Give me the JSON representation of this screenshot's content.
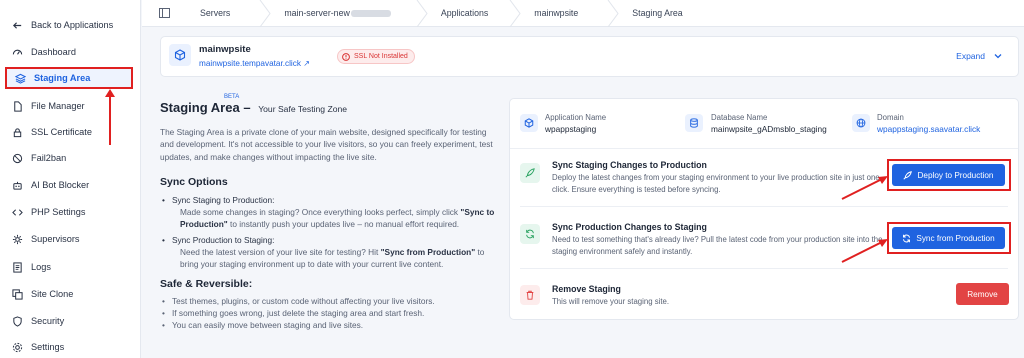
{
  "sidebar": {
    "back_label": "Back to Applications",
    "items": [
      {
        "label": "Dashboard",
        "icon": "dashboard-icon"
      },
      {
        "label": "Staging Area",
        "icon": "layers-icon"
      },
      {
        "label": "File Manager",
        "icon": "file-icon"
      },
      {
        "label": "SSL Certificate",
        "icon": "lock-icon"
      },
      {
        "label": "Fail2ban",
        "icon": "ban-icon"
      },
      {
        "label": "AI Bot Blocker",
        "icon": "robot-icon"
      },
      {
        "label": "PHP Settings",
        "icon": "code-icon"
      },
      {
        "label": "Supervisors",
        "icon": "gear-icon"
      },
      {
        "label": "Logs",
        "icon": "log-icon"
      },
      {
        "label": "Site Clone",
        "icon": "copy-icon"
      },
      {
        "label": "Security",
        "icon": "shield-icon"
      },
      {
        "label": "Settings",
        "icon": "settings-icon"
      }
    ]
  },
  "breadcrumb": {
    "items": [
      "Servers",
      "main-server-new",
      "Applications",
      "mainwpsite",
      "Staging Area"
    ]
  },
  "site": {
    "name": "mainwpsite",
    "url": "mainwpsite.tempavatar.click",
    "ssl_badge": "SSL Not Installed",
    "expand_label": "Expand"
  },
  "intro": {
    "title": "Staging Area",
    "beta": "BETA",
    "subtitle": "Your Safe Testing Zone",
    "description": "The Staging Area is a private clone of your main website, designed specifically for testing and development. It's not accessible to your live visitors, so you can freely experiment, test updates, and make changes without impacting the live site."
  },
  "sync_options": {
    "heading": "Sync Options",
    "items": [
      {
        "title": "Sync Staging to Production:",
        "pre": "Made some changes in staging? Once everything looks perfect, simply click ",
        "bold": "\"Sync to Production\"",
        "post": " to instantly push your updates live – no manual effort required."
      },
      {
        "title": "Sync Production to Staging:",
        "pre": "Need the latest version of your live site for testing? Hit ",
        "bold": "\"Sync from Production\"",
        "post": " to bring your staging environment up to date with your current live content."
      }
    ]
  },
  "safe": {
    "heading": "Safe & Reversible:",
    "items": [
      "Test themes, plugins, or custom code without affecting your live visitors.",
      "If something goes wrong, just delete the staging area and start fresh.",
      "You can easily move between staging and live sites."
    ]
  },
  "info": {
    "app_label": "Application Name",
    "app_value": "wpappstaging",
    "db_label": "Database Name",
    "db_value": "mainwpsite_gADmsblo_staging",
    "domain_label": "Domain",
    "domain_value": "wpappstaging.saavatar.click"
  },
  "actions": {
    "deploy": {
      "title": "Sync Staging Changes to Production",
      "desc": "Deploy the latest changes from your staging environment to your live production site in just one click. Ensure everything is tested before syncing.",
      "button": "Deploy to Production"
    },
    "sync": {
      "title": "Sync Production Changes to Staging",
      "desc": "Need to test something that's already live? Pull the latest code from your production site into the staging environment safely and instantly.",
      "button": "Sync from Production"
    },
    "remove": {
      "title": "Remove Staging",
      "desc": "This will remove your staging site.",
      "button": "Remove"
    }
  },
  "colors": {
    "accent": "#1f63e0",
    "danger": "#e24444",
    "highlight": "#e02020",
    "success_bg": "#e6f6ee"
  }
}
